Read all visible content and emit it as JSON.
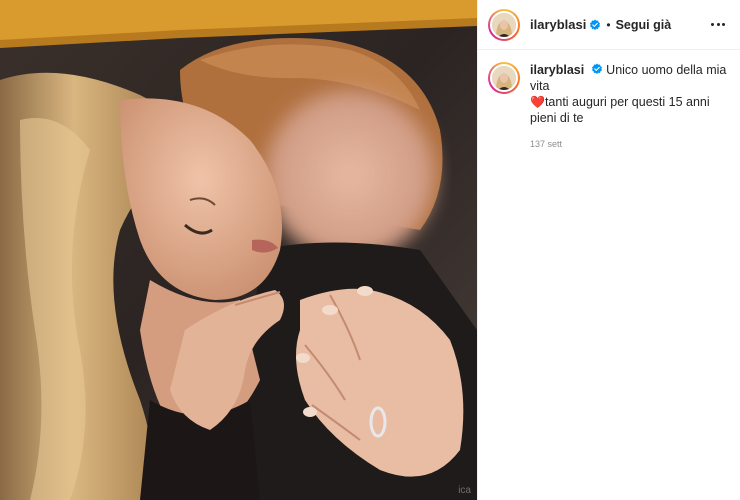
{
  "post": {
    "username": "ilaryblasi",
    "separator": "•",
    "follow_label": "Segui già",
    "more_icon": "more-horizontal-icon"
  },
  "caption": {
    "username": "ilaryblasi",
    "line1": "Unico uomo della mia vita",
    "heart": "❤️",
    "line2": "tanti auguri per questi 15 anni pieni di te",
    "time": "137 sett"
  },
  "media": {
    "watermark": "ica"
  },
  "colors": {
    "verified": "#0095f6",
    "heart": "#e0245e",
    "muted": "#8e8e8e"
  }
}
